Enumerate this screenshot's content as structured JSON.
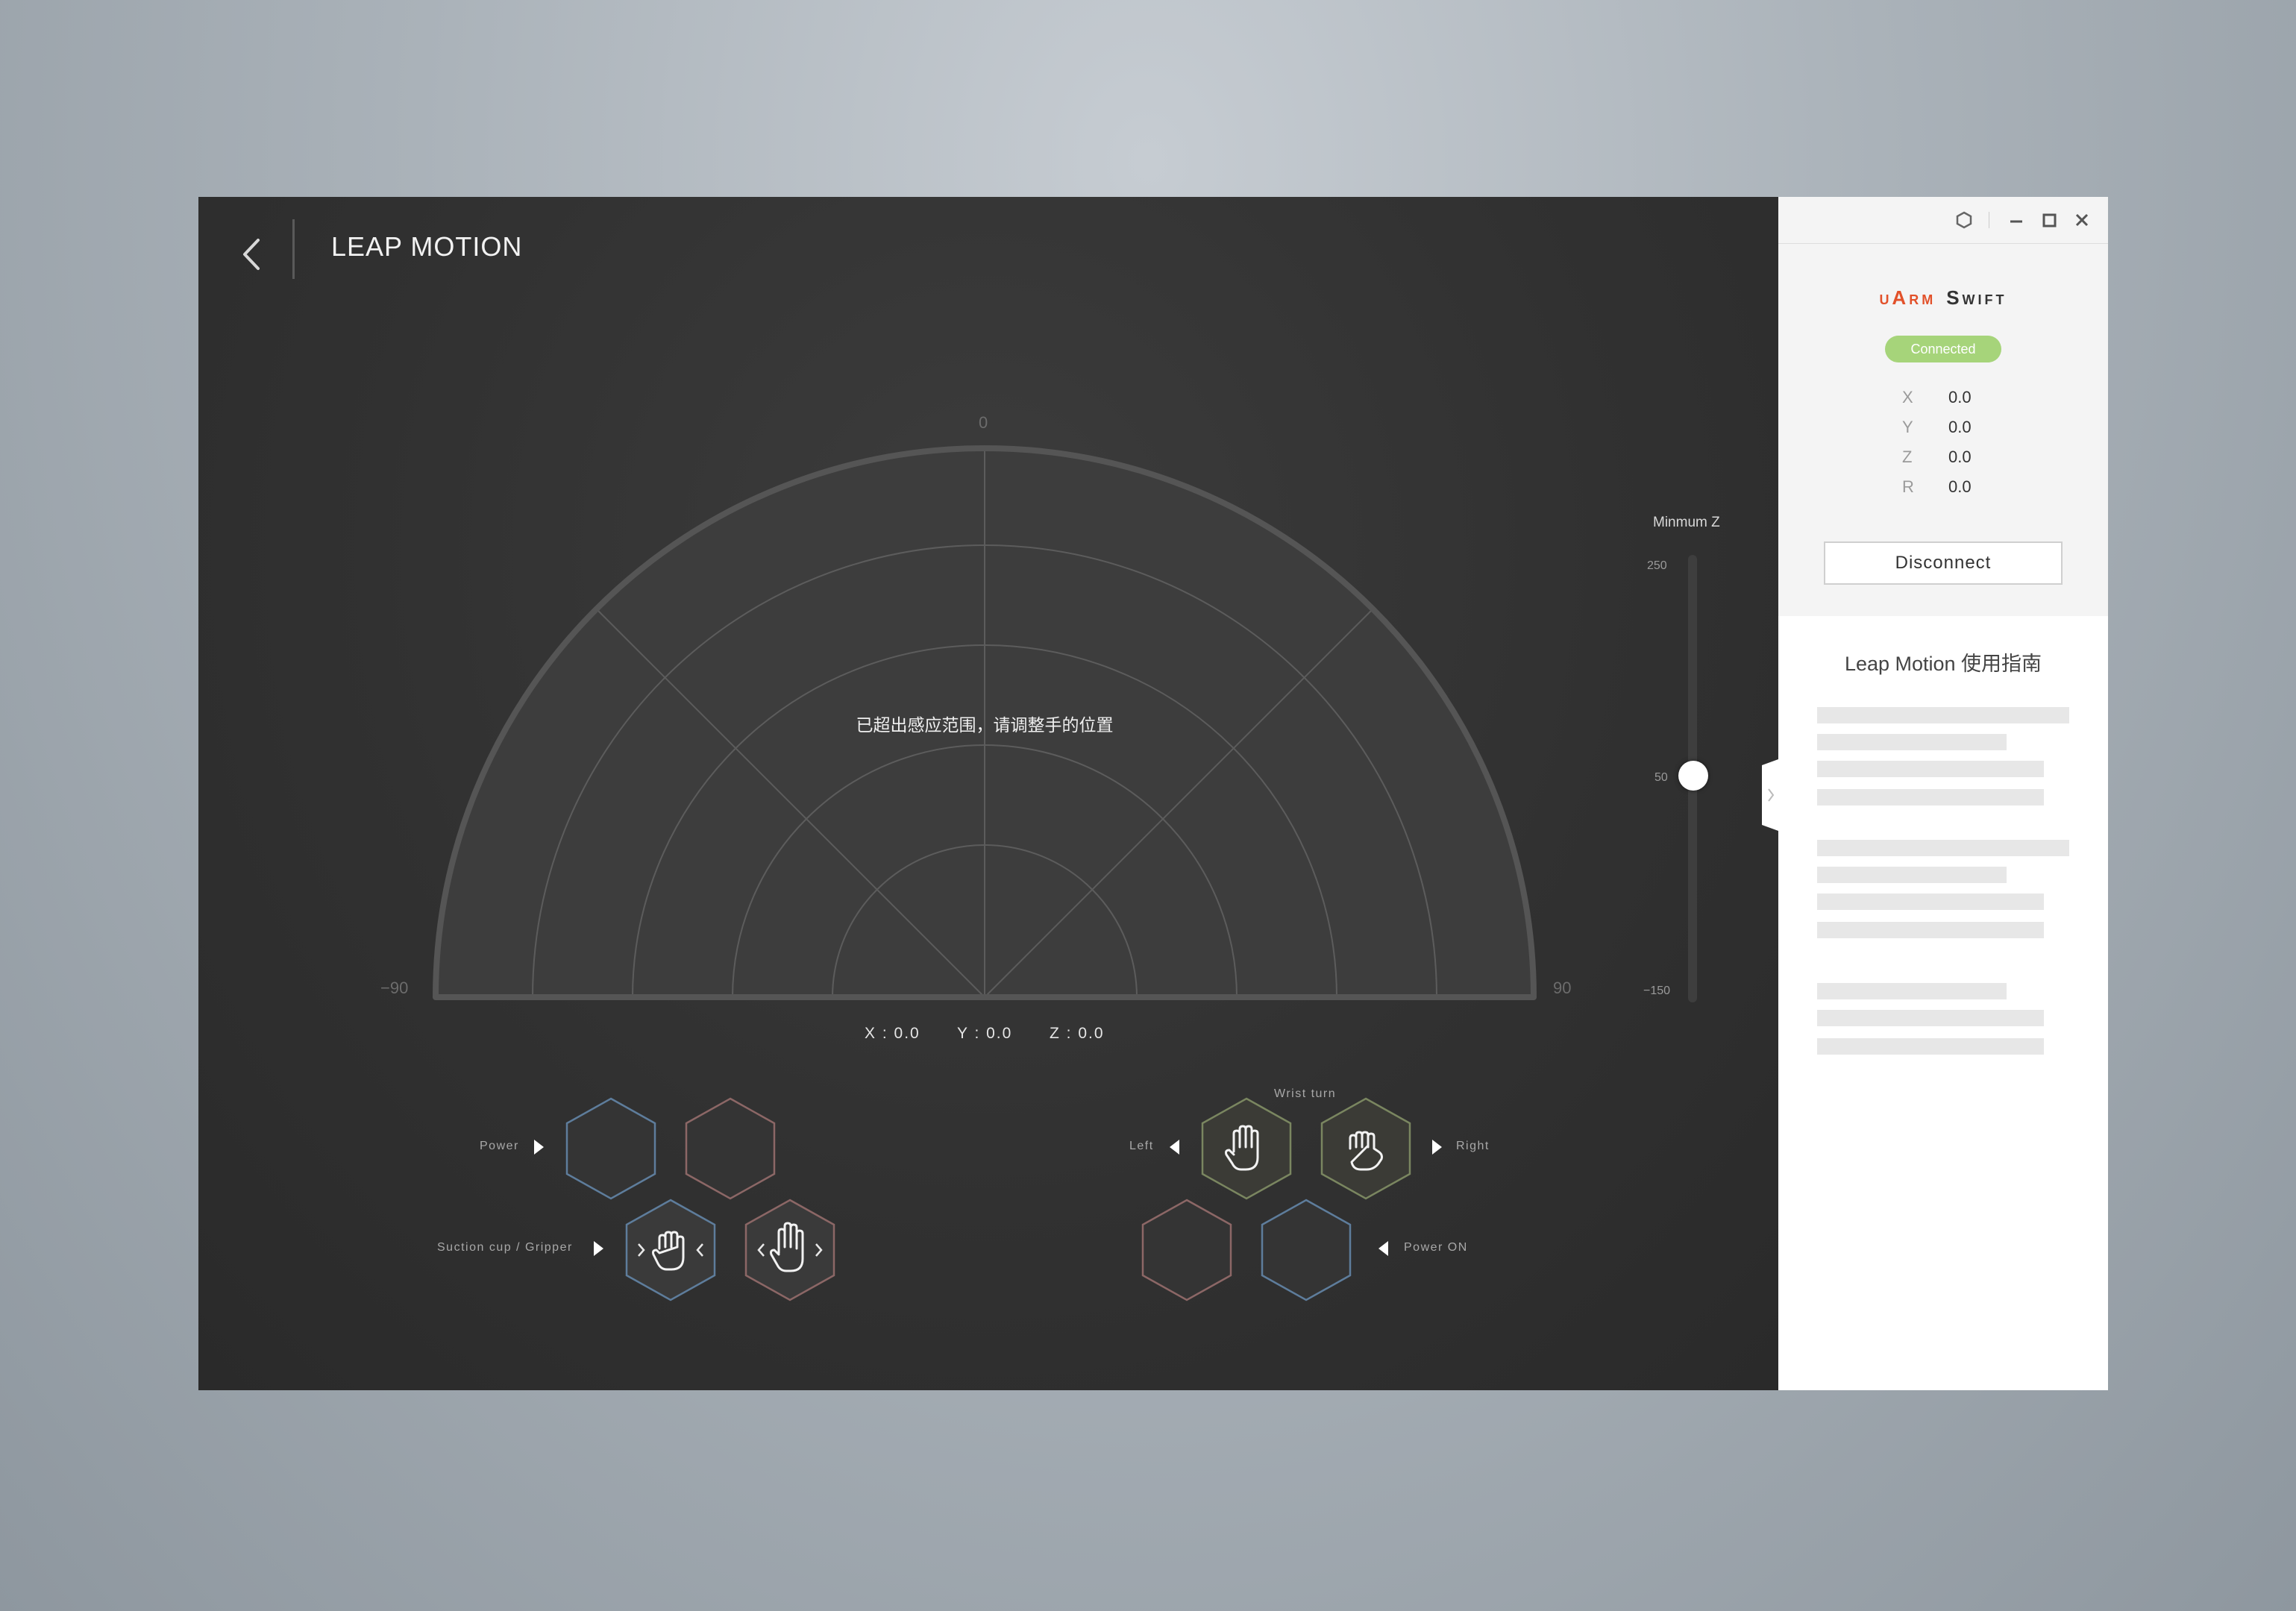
{
  "header": {
    "title": "LEAP MOTION"
  },
  "radar": {
    "warning": "已超出感应范围，请调整手的位置",
    "axis_labels": {
      "top": "0",
      "left": "−90",
      "right": "90"
    },
    "readout": {
      "x": "X : 0.0",
      "y": "Y : 0.0",
      "z": "Z : 0.0"
    }
  },
  "min_z": {
    "title": "Minmum Z",
    "max": "250",
    "mid": "50",
    "min": "−150",
    "value": 50,
    "range": [
      -150,
      250
    ]
  },
  "controls": {
    "power_label": "Power",
    "suction_label": "Suction cup / Gripper",
    "wrist_turn_label": "Wrist turn",
    "left_label": "Left",
    "right_label": "Right",
    "power_on_label": "Power ON"
  },
  "sidebar": {
    "brand_1": "uArm",
    "brand_2": "Swift",
    "status": "Connected",
    "status_color": "#a6d47a",
    "brand_color": "#e2512a",
    "position": [
      {
        "axis": "X",
        "value": "0.0"
      },
      {
        "axis": "Y",
        "value": "0.0"
      },
      {
        "axis": "Z",
        "value": "0.0"
      },
      {
        "axis": "R",
        "value": "0.0"
      }
    ],
    "disconnect_label": "Disconnect",
    "guide_title": "Leap Motion 使用指南"
  },
  "icons": {
    "back": "chevron-left-icon",
    "settings": "hexagon-settings-icon",
    "minimize": "minimize-icon",
    "maximize": "maximize-icon",
    "close": "close-icon",
    "open_hand": "open-hand-icon",
    "fist": "fist-icon"
  }
}
